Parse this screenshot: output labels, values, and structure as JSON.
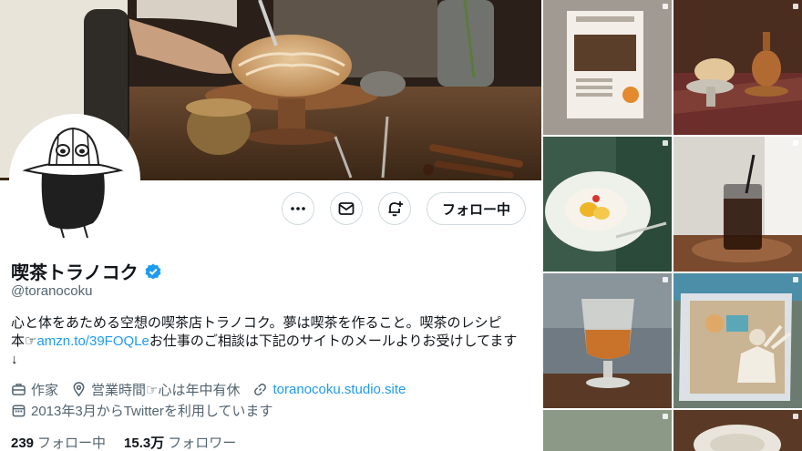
{
  "profile": {
    "display_name": "喫茶トラノコク",
    "handle": "@toranocoku",
    "verified_badge": "verified-icon",
    "bio": {
      "line1": "心と体をあためる空想の喫茶店トラノコク。夢は喫茶を作ること。喫茶のレシピ",
      "line2_prefix": "本☞",
      "line2_link": "amzn.to/39FOQLe",
      "line2_suffix": "お仕事のご相談は下記のサイトのメールよりお受けしてます",
      "line3": "↓"
    },
    "meta": {
      "job": "作家",
      "location": "営業時間☞心は年中有休",
      "website": "toranocoku.studio.site",
      "joined": "2013年3月からTwitterを利用しています"
    },
    "stats": {
      "following_count": "239",
      "following_label": "フォロー中",
      "followers_count": "15.3万",
      "followers_label": "フォロワー"
    }
  },
  "actions": {
    "more_icon": "more-icon",
    "message_icon": "mail-icon",
    "notify_icon": "bell-plus-icon",
    "follow_label": "フォロー中"
  },
  "colors": {
    "accent": "#1d9bf0",
    "text_primary": "#0f1419",
    "text_secondary": "#536471",
    "border": "#cfd9de"
  }
}
